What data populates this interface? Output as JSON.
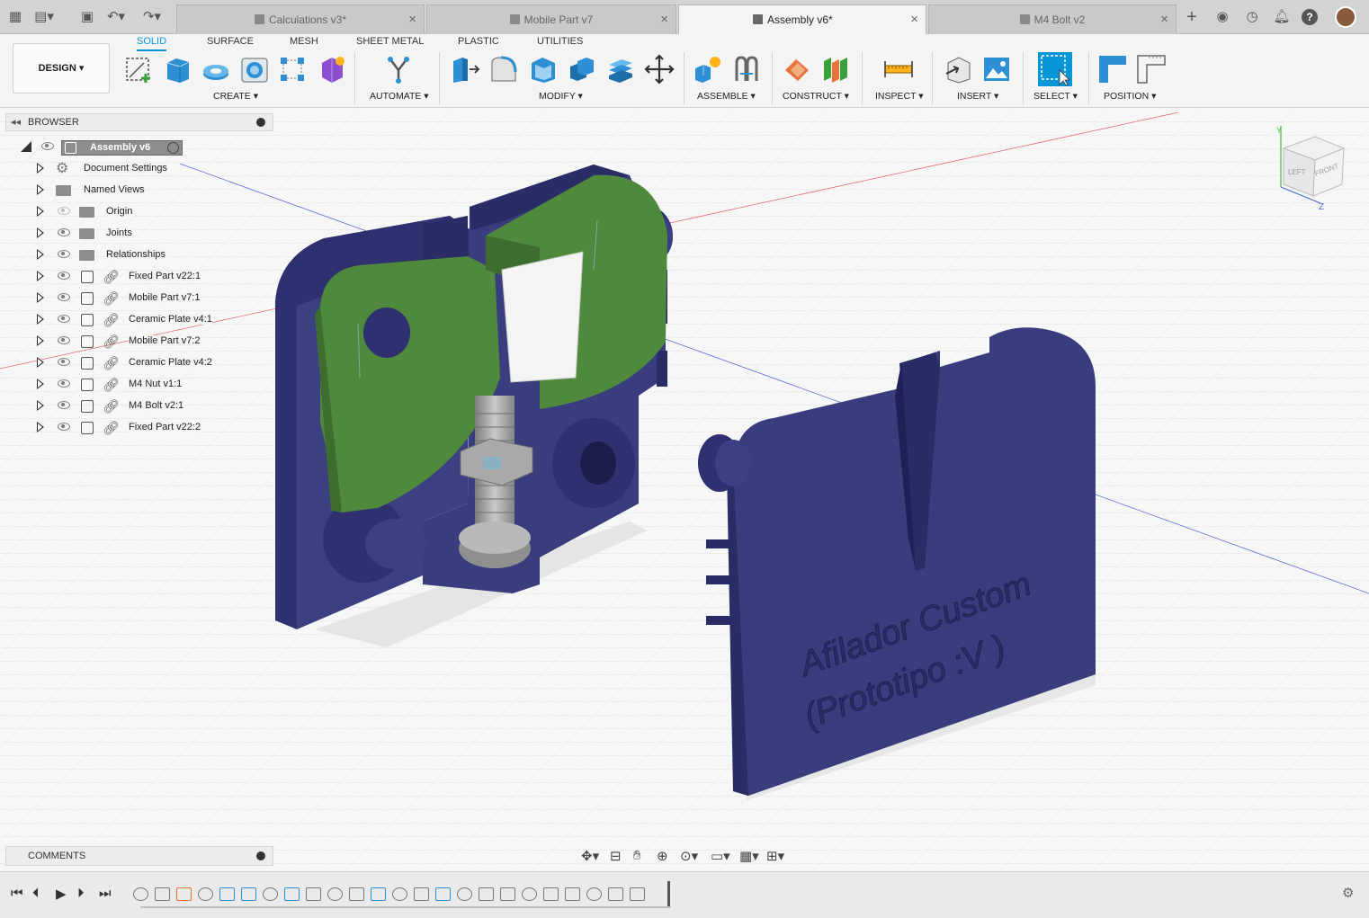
{
  "tabs": [
    {
      "label": "Calculations v3*",
      "active": false
    },
    {
      "label": "Mobile Part v7",
      "active": false
    },
    {
      "label": "Assembly v6*",
      "active": true
    },
    {
      "label": "M4 Bolt v2",
      "active": false
    }
  ],
  "workspace": {
    "design_label": "DESIGN ▾",
    "tabs": [
      "SOLID",
      "SURFACE",
      "MESH",
      "SHEET METAL",
      "PLASTIC",
      "UTILITIES"
    ],
    "active_tab": "SOLID"
  },
  "toolbar_groups": [
    {
      "label": "CREATE ▾"
    },
    {
      "label": "AUTOMATE ▾"
    },
    {
      "label": "MODIFY ▾"
    },
    {
      "label": "ASSEMBLE ▾"
    },
    {
      "label": "CONSTRUCT ▾"
    },
    {
      "label": "INSPECT ▾"
    },
    {
      "label": "INSERT ▾"
    },
    {
      "label": "SELECT ▾"
    },
    {
      "label": "POSITION ▾"
    }
  ],
  "browser": {
    "title": "BROWSER",
    "root": "Assembly v6",
    "items": [
      {
        "label": "Document Settings",
        "icon": "gear-icon"
      },
      {
        "label": "Named Views",
        "icon": "folder-icon"
      },
      {
        "label": "Origin",
        "icon": "folder-icon"
      },
      {
        "label": "Joints",
        "icon": "folder-icon"
      },
      {
        "label": "Relationships",
        "icon": "folder-icon"
      },
      {
        "label": "Fixed Part v22:1",
        "icon": "component-icon"
      },
      {
        "label": "Mobile Part v7:1",
        "icon": "component-icon"
      },
      {
        "label": "Ceramic Plate v4:1",
        "icon": "component-icon"
      },
      {
        "label": "Mobile Part v7:2",
        "icon": "component-icon"
      },
      {
        "label": "Ceramic Plate v4:2",
        "icon": "component-icon"
      },
      {
        "label": "M4 Nut v1:1",
        "icon": "component-icon"
      },
      {
        "label": "M4 Bolt v2:1",
        "icon": "component-icon"
      },
      {
        "label": "Fixed Part v22:2",
        "icon": "component-icon"
      }
    ]
  },
  "viewcube": {
    "left": "LEFT",
    "front": "FRONT",
    "axis_z": "Z",
    "axis_y": "Y"
  },
  "model": {
    "engraving_line1": "Afilador Custom",
    "engraving_line2": "(Prototipo :V )"
  },
  "comments": {
    "title": "COMMENTS"
  },
  "colors": {
    "accent": "#0696d7",
    "part_blue": "#3c3f7a",
    "part_green": "#4f8a3c"
  }
}
